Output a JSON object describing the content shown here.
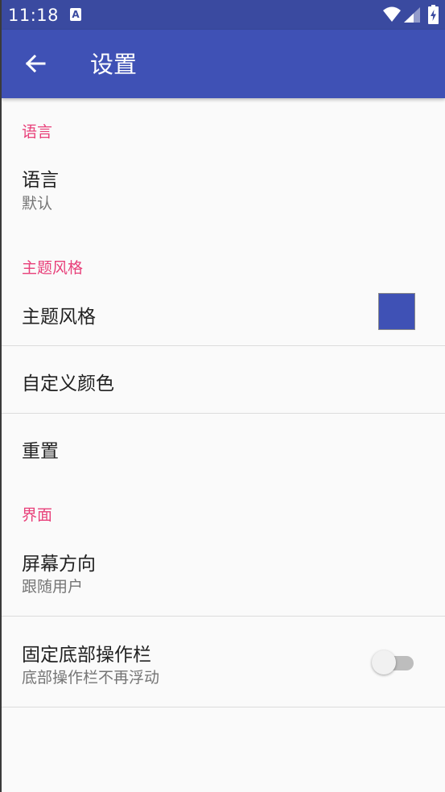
{
  "status_bar": {
    "time": "11:18",
    "notification_icon": "A"
  },
  "app_bar": {
    "title": "设置",
    "back_icon": "arrow-left-icon"
  },
  "sections": {
    "language": {
      "header": "语言",
      "item": {
        "title": "语言",
        "summary": "默认"
      }
    },
    "theme": {
      "header": "主题风格",
      "theme_item": {
        "title": "主题风格",
        "swatch_color": "#3f51b5"
      },
      "custom_color_item": {
        "title": "自定义颜色"
      },
      "reset_item": {
        "title": "重置"
      }
    },
    "interface": {
      "header": "界面",
      "orientation_item": {
        "title": "屏幕方向",
        "summary": "跟随用户"
      },
      "fixed_bar_item": {
        "title": "固定底部操作栏",
        "summary": "底部操作栏不再浮动",
        "switch_on": false
      }
    }
  },
  "colors": {
    "status_bar": "#3a4aa0",
    "app_bar": "#3f51b5",
    "category_text": "#e8407a",
    "background": "#fafafa"
  }
}
